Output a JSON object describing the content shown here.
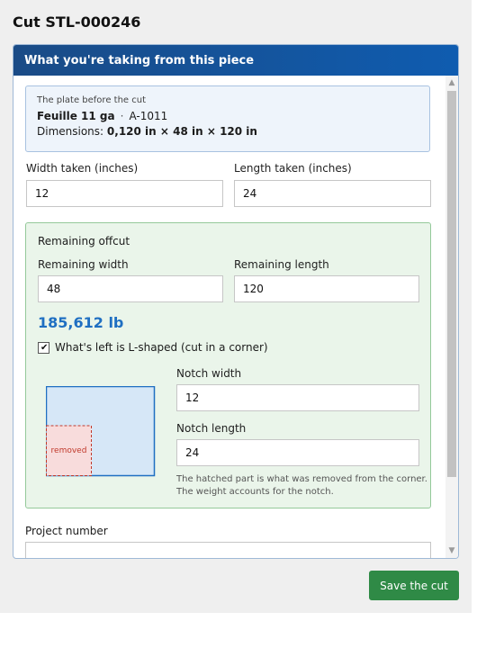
{
  "page": {
    "title": "Cut STL-000246"
  },
  "card": {
    "header": "What you're taking from this piece"
  },
  "plate": {
    "caption": "The plate before the cut",
    "name": "Feuille 11 ga",
    "separator": "·",
    "code": "A-1011",
    "dimensions_label": "Dimensions:",
    "dimensions_value": "0,120 in × 48 in × 120 in"
  },
  "taken": {
    "width_label": "Width taken (inches)",
    "width_value": "12",
    "length_label": "Length taken (inches)",
    "length_value": "24"
  },
  "offcut": {
    "title": "Remaining offcut",
    "width_label": "Remaining width",
    "width_value": "48",
    "length_label": "Remaining length",
    "length_value": "120",
    "weight": "185,612 lb",
    "l_shaped_label": "What's left is L-shaped (cut in a corner)",
    "l_shaped_checked": true,
    "notch_width_label": "Notch width",
    "notch_width_value": "12",
    "notch_length_label": "Notch length",
    "notch_length_value": "24",
    "removed_label": "removed",
    "hint_line1": "The hatched part is what was removed from the corner.",
    "hint_line2": "The weight accounts for the notch."
  },
  "project": {
    "label": "Project number",
    "value": ""
  },
  "actions": {
    "save_label": "Save the cut"
  },
  "colors": {
    "header": "#0f5cb0",
    "accent_blue": "#1f6fc2",
    "offcut_bg": "#eaf5ea",
    "save_button": "#2f8a46",
    "removed_fill": "#f8dcdc",
    "removed_text": "#c0392b"
  }
}
